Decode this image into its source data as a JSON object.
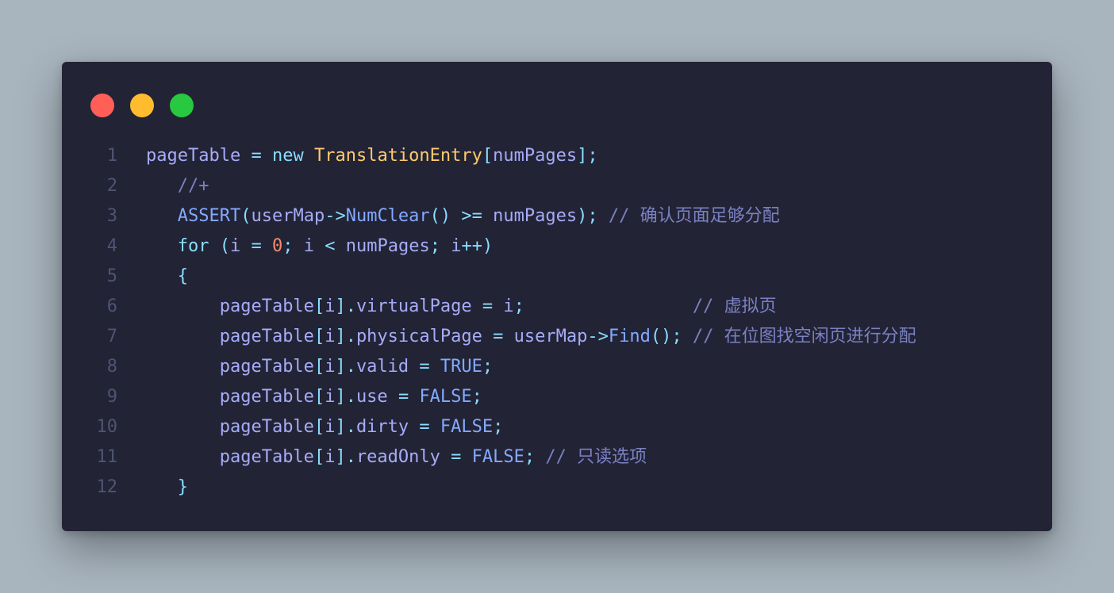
{
  "colors": {
    "page_background": "#a8b4be",
    "editor_background": "#232336",
    "dot_red": "#ff5f57",
    "dot_yellow": "#febc2e",
    "dot_green": "#28c840"
  },
  "window_controls": [
    "close",
    "minimize",
    "maximize"
  ],
  "code": {
    "line_numbers": [
      "1",
      "2",
      "3",
      "4",
      "5",
      "6",
      "7",
      "8",
      "9",
      "10",
      "11",
      "12"
    ],
    "lines": [
      "pageTable = new TranslationEntry[numPages];",
      "   //+",
      "   ASSERT(userMap->NumClear() >= numPages); // 确认页面足够分配",
      "   for (i = 0; i < numPages; i++)",
      "   {",
      "       pageTable[i].virtualPage = i;                // 虚拟页",
      "       pageTable[i].physicalPage = userMap->Find(); // 在位图找空闲页进行分配",
      "       pageTable[i].valid = TRUE;",
      "       pageTable[i].use = FALSE;",
      "       pageTable[i].dirty = FALSE;",
      "       pageTable[i].readOnly = FALSE; // 只读选项",
      "   }"
    ]
  }
}
